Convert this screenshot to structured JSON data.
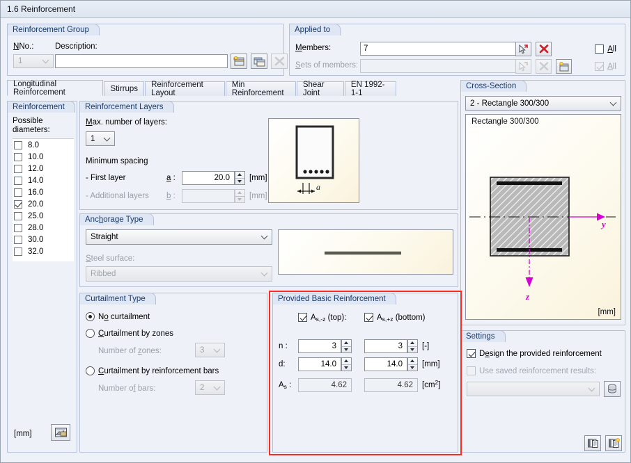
{
  "window": {
    "title": "1.6 Reinforcement"
  },
  "reinforcement_group": {
    "title": "Reinforcement Group",
    "no_label": "No.:",
    "no_value": "1",
    "description_label": "Description:",
    "description_value": "",
    "buttons": {
      "new": "new-group",
      "copy": "copy-group",
      "delete": "delete-group"
    }
  },
  "applied_to": {
    "title": "Applied to",
    "members_label": "Members:",
    "members_value": "7",
    "members_all_label": "All",
    "members_all_checked": false,
    "sets_label": "Sets of members:",
    "sets_value": "",
    "sets_all_label": "All",
    "sets_all_checked": true
  },
  "tabs": [
    {
      "label": "Longitudinal Reinforcement",
      "active": true
    },
    {
      "label": "Stirrups",
      "active": false
    },
    {
      "label": "Reinforcement Layout",
      "active": false
    },
    {
      "label": "Min Reinforcement",
      "active": false
    },
    {
      "label": "Shear Joint",
      "active": false
    },
    {
      "label": "EN 1992-1-1",
      "active": false
    }
  ],
  "reinforcement": {
    "title": "Reinforcement",
    "possible_diameters_label": "Possible\ndiameters:",
    "possible_diameters_line1": "Possible",
    "possible_diameters_line2": "diameters:",
    "diameters": [
      {
        "value": "8.0",
        "checked": false
      },
      {
        "value": "10.0",
        "checked": false
      },
      {
        "value": "12.0",
        "checked": false
      },
      {
        "value": "14.0",
        "checked": false
      },
      {
        "value": "16.0",
        "checked": false
      },
      {
        "value": "20.0",
        "checked": true
      },
      {
        "value": "25.0",
        "checked": false
      },
      {
        "value": "28.0",
        "checked": false
      },
      {
        "value": "30.0",
        "checked": false
      },
      {
        "value": "32.0",
        "checked": false
      }
    ],
    "unit": "[mm]"
  },
  "reinforcement_layers": {
    "title": "Reinforcement Layers",
    "max_layers_label": "Max. number of layers:",
    "max_layers_value": "1",
    "min_spacing_label": "Minimum spacing",
    "first_layer_label": "- First layer",
    "first_layer_symbol": "a :",
    "first_layer_value": "20.0",
    "first_layer_unit": "[mm]",
    "additional_layers_label": "- Additional layers",
    "additional_layers_symbol": "b :",
    "additional_layers_value": "",
    "additional_layers_unit": "[mm]",
    "diagram_dim_label": "a"
  },
  "anchorage": {
    "title": "Anchorage Type",
    "type_value": "Straight",
    "steel_surface_label": "Steel surface:",
    "steel_surface_value": "Ribbed"
  },
  "curtailment": {
    "title": "Curtailment Type",
    "options": [
      {
        "label": "No curtailment",
        "selected": true
      },
      {
        "label": "Curtailment by zones",
        "selected": false
      },
      {
        "label": "Curtailment by reinforcement bars",
        "selected": false
      }
    ],
    "zones_label": "Number of zones:",
    "zones_value": "3",
    "bars_label": "Number of bars:",
    "bars_value": "2"
  },
  "provided_basic": {
    "title": "Provided Basic Reinforcement",
    "highlight_color": "#ff2a21",
    "top_checkbox_label_main": "A",
    "top_checkbox_sub": "s,-z",
    "top_checkbox_tail": " (top):",
    "top_checked": true,
    "bottom_checkbox_label_main": "A",
    "bottom_checkbox_sub": "s,+z",
    "bottom_checkbox_tail": " (bottom)",
    "bottom_checked": true,
    "rows": [
      {
        "label": "n :",
        "top": "3",
        "bottom": "3",
        "unit": "[-]"
      },
      {
        "label": "d:",
        "top": "14.0",
        "bottom": "14.0",
        "unit": "[mm]"
      }
    ],
    "as_label_main": "A",
    "as_label_sub": "s",
    "as_label_tail": " :",
    "as_top": "4.62",
    "as_bottom": "4.62",
    "as_unit_main": "[cm",
    "as_unit_sup": "2",
    "as_unit_tail": "]"
  },
  "cross_section": {
    "title": "Cross-Section",
    "selected": "2 - Rectangle 300/300",
    "caption": "Rectangle 300/300",
    "unit": "[mm]",
    "axis_y": "y",
    "axis_z": "z",
    "axis_color": "#d400d4"
  },
  "settings": {
    "title": "Settings",
    "design_label": "Design the provided reinforcement",
    "design_checked": true,
    "saved_results_label": "Use saved reinforcement results:",
    "saved_results_checked": false,
    "saved_results_value": ""
  },
  "footer": {
    "copy_icon": "copy-to-clipboard-icon",
    "paste_icon": "paste-from-clipboard-icon"
  }
}
